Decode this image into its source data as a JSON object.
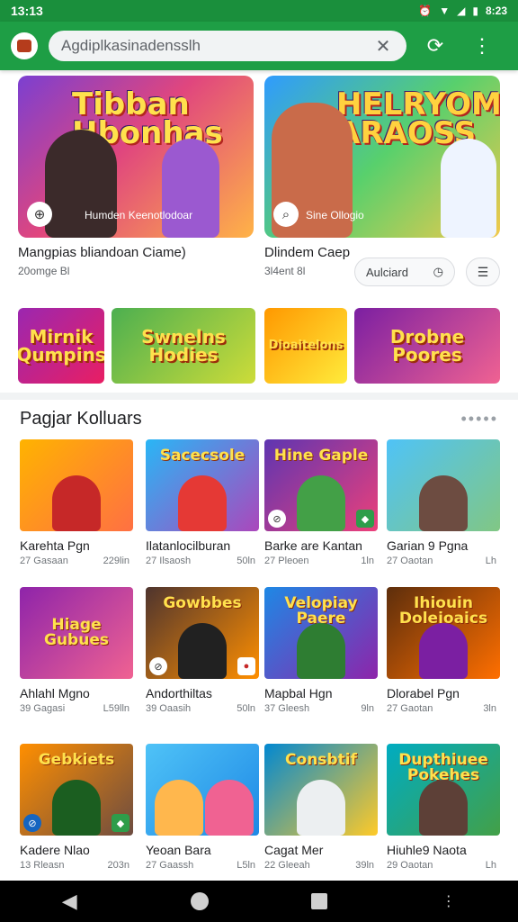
{
  "status_bar": {
    "time": "13:13",
    "clock": "8:23"
  },
  "search": {
    "query": "Agdiplkasinadensslh"
  },
  "featured": [
    {
      "art_title": "Tibban Hbonhas",
      "caption": "Humden Keenotlodoar",
      "title": "Mangpias bliandoan Ciame)",
      "sub": "20omge   Bl"
    },
    {
      "art_title": "HELRYOM ARAOSS",
      "caption": "Sine          Ollogio",
      "title": "Dlindem Caep",
      "sub": "3l4ent   8l"
    }
  ],
  "actions": {
    "pill_label": "Aulciard"
  },
  "banners": [
    {
      "text": "Mirnik Qumpins"
    },
    {
      "text": "Swnelns Hodies"
    },
    {
      "text": "Dioaitelons"
    },
    {
      "text": "Drobne Poores"
    }
  ],
  "section": {
    "title": "Pagjar Kolluars",
    "more": "•••••"
  },
  "tiles": [
    {
      "art": "",
      "name": "Karehta Pgn",
      "meta_a": "27 Gasaan",
      "meta_b": "229lin"
    },
    {
      "art": "Sacecsole",
      "name": "Ilatanlocilburan",
      "meta_a": "27 Ilsaosh",
      "meta_b": "50ln"
    },
    {
      "art": "Hine Gaple",
      "name": "Barke are Kantan",
      "meta_a": "27 Pleoen",
      "meta_b": "1ln"
    },
    {
      "art": "",
      "name": "Garian 9 Pgna",
      "meta_a": "27 Oaotan",
      "meta_b": "Lh"
    },
    {
      "art": "Hiage Gubues",
      "name": "Ahlahl Mgno",
      "meta_a": "39 Gagasi",
      "meta_b": "L59lln"
    },
    {
      "art": "Gowbbes",
      "name": "Andorthiltas",
      "meta_a": "39 Oaasih",
      "meta_b": "50ln"
    },
    {
      "art": "Velopiay Paere",
      "name": "Mapbal Hgn",
      "meta_a": "37 Gleesh",
      "meta_b": "9ln"
    },
    {
      "art": "Ihiouin Doleioaics",
      "name": "Dlorabel Pgn",
      "meta_a": "27 Gaotan",
      "meta_b": "3ln"
    },
    {
      "art": "Gebkiets",
      "name": "Kadere Nlao",
      "meta_a": "13 Rleasn",
      "meta_b": "203n"
    },
    {
      "art": "",
      "name": "Yeoan Bara",
      "meta_a": "27 Gaassh",
      "meta_b": "L5ln"
    },
    {
      "art": "Consbtif",
      "name": "Cagat Mer",
      "meta_a": "22 Gleeah",
      "meta_b": "39ln"
    },
    {
      "art": "Dupthiuee Pokehes",
      "name": "Hiuhle9 Naota",
      "meta_a": "29 Oaotan",
      "meta_b": "Lh"
    }
  ],
  "colors": {
    "app_bar": "#1e9e45",
    "status_bar": "#1a8f3c",
    "nav_bar": "#000000"
  },
  "icons": {
    "app": "app-logo-icon",
    "clear": "close-icon",
    "refresh": "refresh-icon",
    "menu": "overflow-menu-icon"
  }
}
